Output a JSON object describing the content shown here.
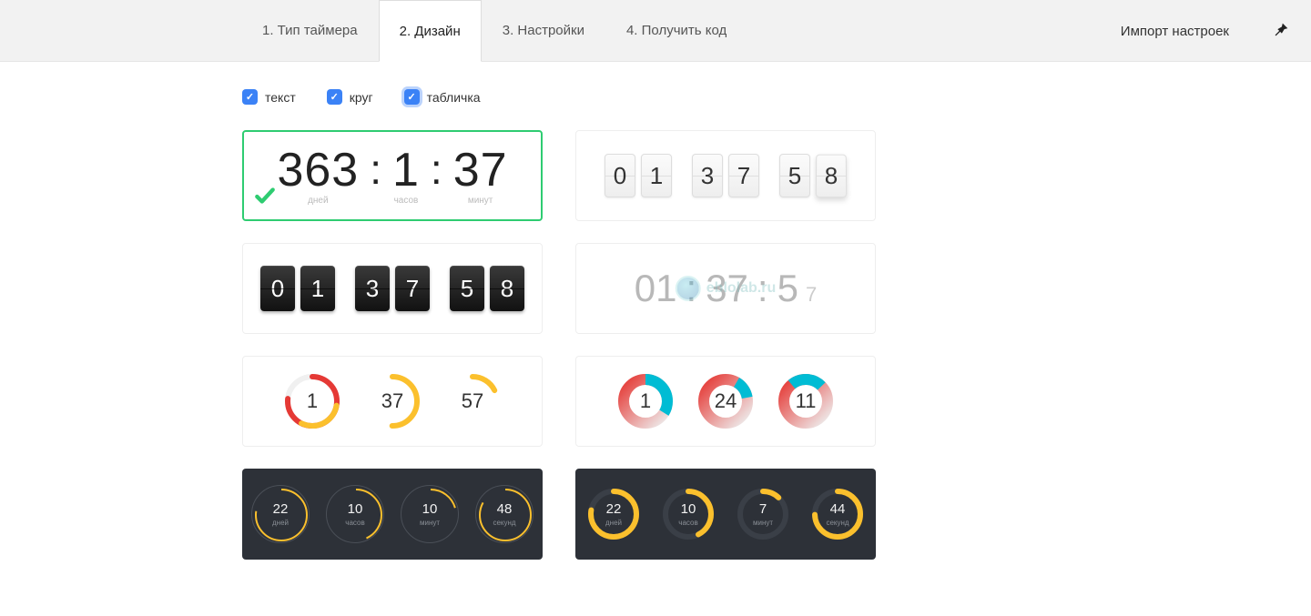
{
  "tabs": {
    "t1": "1. Тип таймера",
    "t2": "2. Дизайн",
    "t3": "3. Настройки",
    "t4": "4. Получить код"
  },
  "import_label": "Импорт настроек",
  "filters": {
    "text": "текст",
    "circle": "круг",
    "tablet": "табличка"
  },
  "style1": {
    "days": "363",
    "days_l": "дней",
    "hours": "1",
    "hours_l": "часов",
    "minutes": "37",
    "minutes_l": "минут"
  },
  "style2": {
    "d1": "0",
    "d2": "1",
    "d3": "3",
    "d4": "7",
    "d5": "5",
    "d6": "8"
  },
  "style3": {
    "d1": "0",
    "d2": "1",
    "d3": "3",
    "d4": "7",
    "d5": "5",
    "d6": "8"
  },
  "style4": {
    "a": "01",
    "b": "37",
    "c": "5",
    "sec": "7"
  },
  "style5": {
    "v1": "1",
    "v2": "37",
    "v3": "57"
  },
  "style6": {
    "v1": "1",
    "v2": "24",
    "v3": "11"
  },
  "style7": {
    "n1": "22",
    "l1": "дней",
    "n2": "10",
    "l2": "часов",
    "n3": "10",
    "l3": "минут",
    "n4": "48",
    "l4": "секунд"
  },
  "style8": {
    "n1": "22",
    "l1": "дней",
    "n2": "10",
    "l2": "часов",
    "n3": "7",
    "l3": "минут",
    "n4": "44",
    "l4": "секунд"
  },
  "watermark": "eblolab.ru"
}
